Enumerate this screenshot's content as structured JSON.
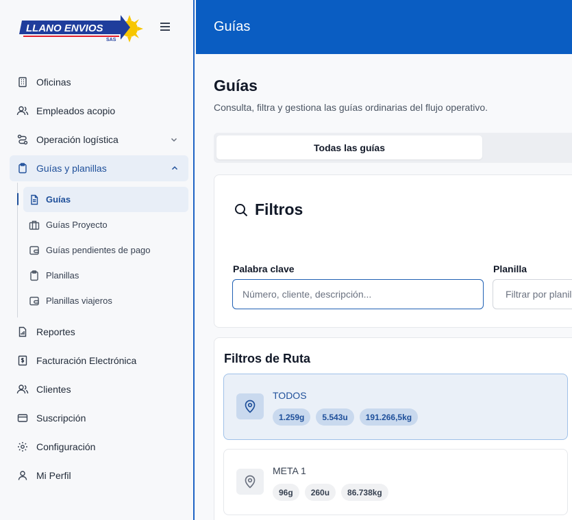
{
  "brand": {
    "logo_text": "LLANO ENVIOS",
    "logo_sub": "SAS",
    "accent": "#0a5dc2",
    "logo_blue": "#1f3d9c",
    "logo_sun": "#f7c600"
  },
  "sidebar": {
    "items": [
      {
        "label": "Oficinas",
        "icon": "building-icon"
      },
      {
        "label": "Empleados acopio",
        "icon": "users-icon"
      },
      {
        "label": "Operación logística",
        "icon": "route-icon",
        "chevron": "chevron-down-icon"
      },
      {
        "label": "Guías y planillas",
        "icon": "clipboard-icon",
        "chevron": "chevron-up-icon"
      },
      {
        "label": "Reportes",
        "icon": "report-icon"
      },
      {
        "label": "Facturación Electrónica",
        "icon": "invoice-icon"
      },
      {
        "label": "Clientes",
        "icon": "users-icon"
      },
      {
        "label": "Suscripción",
        "icon": "credit-card-icon"
      },
      {
        "label": "Configuración",
        "icon": "gear-icon"
      },
      {
        "label": "Mi Perfil",
        "icon": "user-icon"
      }
    ],
    "subitems": [
      {
        "label": "Guías",
        "icon": "document-icon"
      },
      {
        "label": "Guías Proyecto",
        "icon": "briefcase-icon"
      },
      {
        "label": "Guías pendientes de pago",
        "icon": "wallet-icon"
      },
      {
        "label": "Planillas",
        "icon": "clipboard-icon"
      },
      {
        "label": "Planillas viajeros",
        "icon": "wallet-icon"
      }
    ]
  },
  "header": {
    "title": "Guías"
  },
  "main": {
    "title": "Guías",
    "subtitle": "Consulta, filtra y gestiona las guías ordinarias del flujo operativo.",
    "tabs": [
      {
        "label": "Todas las guías"
      }
    ],
    "filters": {
      "title": "Filtros",
      "keyword_label": "Palabra clave",
      "keyword_placeholder": "Número, cliente, descripción...",
      "keyword_value": "",
      "planilla_label": "Planilla",
      "planilla_placeholder": "Filtrar por planilla",
      "planilla_value": ""
    },
    "routes": {
      "title": "Filtros de Ruta",
      "items": [
        {
          "name": "TODOS",
          "guias": "1.259g",
          "unidades": "5.543u",
          "peso": "191.266,5kg"
        },
        {
          "name": "META 1",
          "guias": "96g",
          "unidades": "260u",
          "peso": "86.738kg"
        }
      ]
    }
  }
}
